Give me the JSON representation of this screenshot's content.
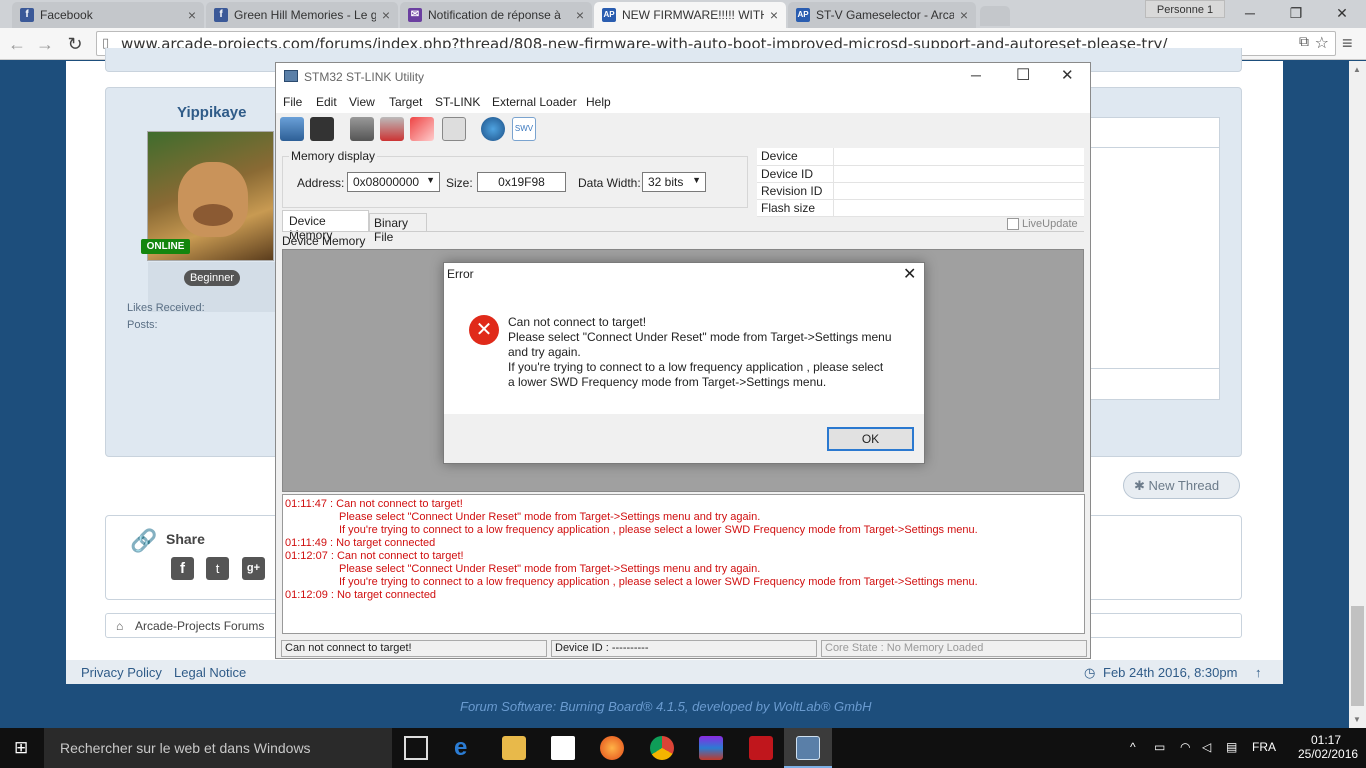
{
  "browser": {
    "tabs": [
      {
        "title": "Facebook",
        "color": "#3b5998",
        "glyph": "f"
      },
      {
        "title": "Green Hill Memories - Le g",
        "color": "#3b5998",
        "glyph": "f"
      },
      {
        "title": "Notification de réponse à",
        "color": "#6b3fa0",
        "glyph": "✉"
      },
      {
        "title": "NEW FIRMWARE!!!!! WITH",
        "color": "#2a5db0",
        "glyph": "AP"
      },
      {
        "title": "ST-V Gameselector - Arca",
        "color": "#2a5db0",
        "glyph": "AP"
      }
    ],
    "profile": "Personne 1",
    "url": "www.arcade-projects.com/forums/index.php?thread/808-new-firmware-with-auto-boot-improved-microsd-support-and-autoreset-please-try/"
  },
  "forum": {
    "username": "Yippikaye",
    "online_badge": "ONLINE",
    "rank": "Beginner",
    "likes_label": "Likes Received:",
    "posts_label": "Posts:",
    "new_thread": "New Thread",
    "share_title": "Share",
    "breadcrumb": "Arcade-Projects Forums",
    "privacy": "Privacy Policy",
    "legal": "Legal Notice",
    "post_date": "Feb 24th 2016, 8:30pm",
    "credit": "Forum Software: Burning Board® 4.1.5, developed by WoltLab® GmbH"
  },
  "app": {
    "title": "STM32 ST-LINK Utility",
    "menu": [
      "File",
      "Edit",
      "View",
      "Target",
      "ST-LINK",
      "External Loader",
      "Help"
    ],
    "memory_display_label": "Memory display",
    "address_label": "Address:",
    "address_value": "0x08000000",
    "size_label": "Size:",
    "size_value": "0x19F98",
    "data_width_label": "Data Width:",
    "data_width_value": "32 bits",
    "info_rows": [
      "Device",
      "Device ID",
      "Revision ID",
      "Flash size"
    ],
    "tab_device_memory": "Device Memory",
    "tab_binary_file": "Binary File",
    "live_update": "LiveUpdate",
    "device_memory_label": "Device Memory",
    "log": [
      {
        "text": "01:11:47 : Can not connect to target!",
        "indent": false
      },
      {
        "text": "Please select \"Connect Under Reset\" mode from Target->Settings menu and try again.",
        "indent": true
      },
      {
        "text": "If you're trying to connect to a low frequency application , please select a lower SWD Frequency mode from Target->Settings menu.",
        "indent": true
      },
      {
        "text": "01:11:49 : No target connected",
        "indent": false
      },
      {
        "text": "01:12:07 : Can not connect to target!",
        "indent": false
      },
      {
        "text": "Please select \"Connect Under Reset\" mode from Target->Settings menu and try again.",
        "indent": true
      },
      {
        "text": "If you're trying to connect to a low frequency application , please select a lower SWD Frequency mode from Target->Settings menu.",
        "indent": true
      },
      {
        "text": "01:12:09 : No target connected",
        "indent": false
      }
    ],
    "status_left": "Can not connect to target!",
    "status_mid": "Device ID : ----------",
    "status_right": "Core State : No Memory Loaded"
  },
  "dialog": {
    "title": "Error",
    "line1": "Can not connect to target!",
    "line2": "Please select \"Connect Under Reset\" mode from Target->Settings menu",
    "line3": "and try again.",
    "line4": "If you're trying to connect to a low frequency application , please select",
    "line5": "a lower SWD Frequency mode from Target->Settings menu.",
    "ok": "OK"
  },
  "taskbar": {
    "search_placeholder": "Rechercher sur le web et dans Windows",
    "lang": "FRA",
    "time": "01:17",
    "date": "25/02/2016"
  }
}
